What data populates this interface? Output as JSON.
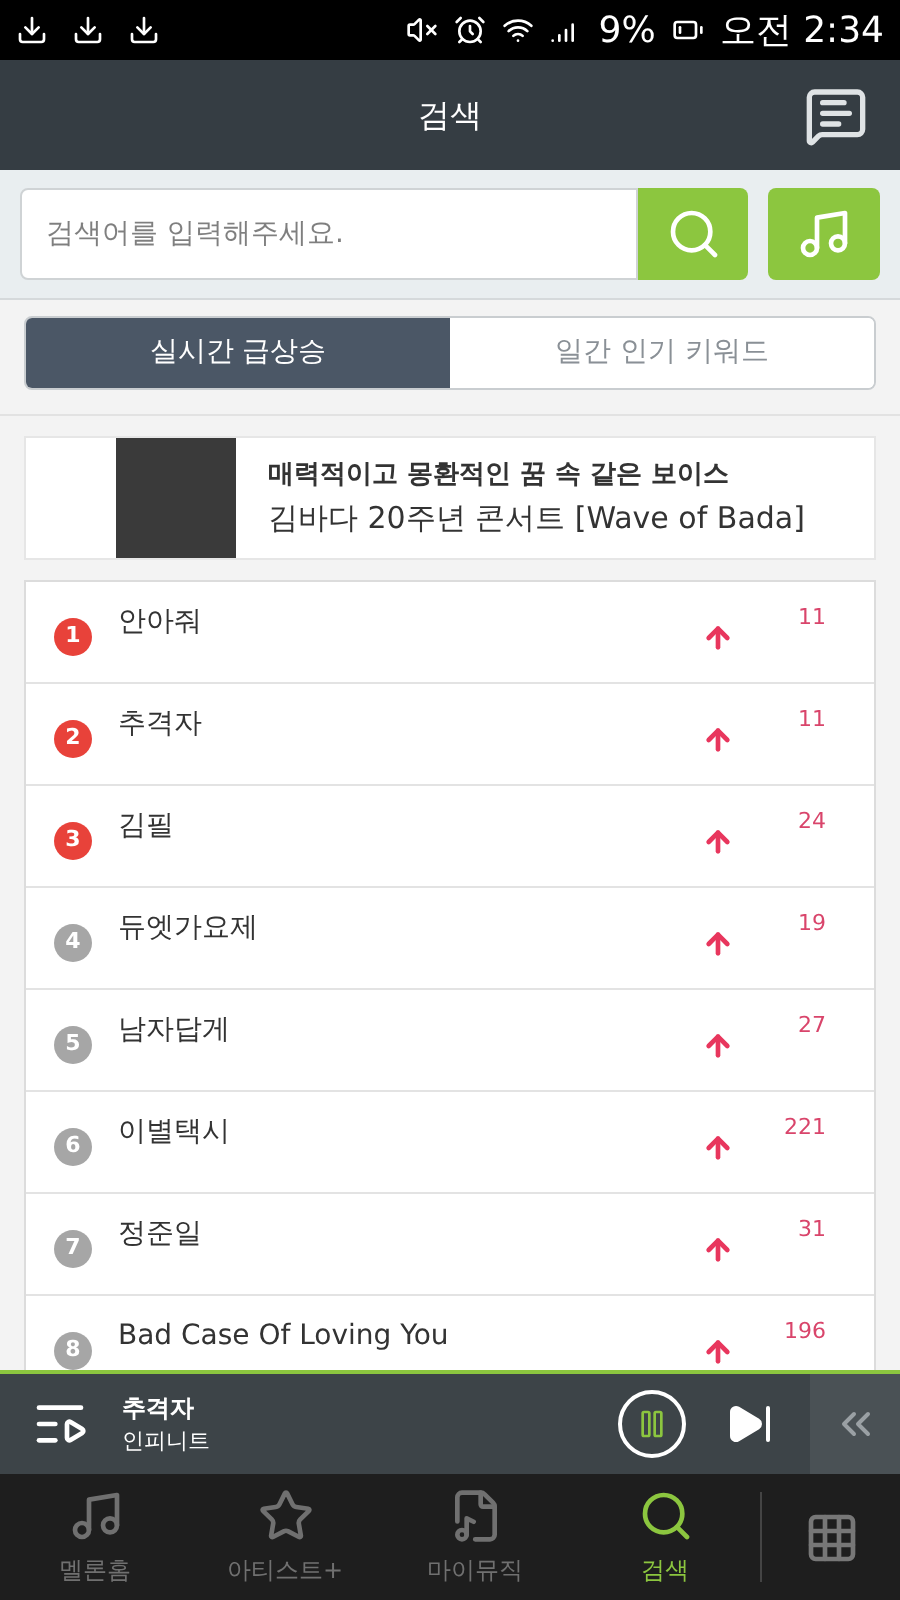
{
  "status_bar": {
    "battery": "9%",
    "time": "오전 2:34"
  },
  "header": {
    "title": "검색"
  },
  "search": {
    "placeholder": "검색어를 입력해주세요."
  },
  "tabs": [
    {
      "label": "실시간 급상승",
      "selected": true
    },
    {
      "label": "일간 인기 키워드",
      "selected": false
    }
  ],
  "banner": {
    "line_1": "매력적이고 몽환적인 꿈 속 같은 보이스",
    "line_2": "김바다 20주년 콘서트 [Wave of Bada]"
  },
  "keywords": [
    {
      "rank": "1",
      "color": "#e8423a",
      "keyword": "안아줘",
      "change": "11"
    },
    {
      "rank": "2",
      "color": "#e8423a",
      "keyword": "추격자",
      "change": "11"
    },
    {
      "rank": "3",
      "color": "#e8423a",
      "keyword": "김필",
      "change": "24"
    },
    {
      "rank": "4",
      "color": "#a6a6a6",
      "keyword": "듀엣가요제",
      "change": "19"
    },
    {
      "rank": "5",
      "color": "#a6a6a6",
      "keyword": "남자답게",
      "change": "27"
    },
    {
      "rank": "6",
      "color": "#a6a6a6",
      "keyword": "이별택시",
      "change": "221"
    },
    {
      "rank": "7",
      "color": "#a6a6a6",
      "keyword": "정준일",
      "change": "31"
    },
    {
      "rank": "8",
      "color": "#a6a6a6",
      "keyword": "Bad Case Of Loving You",
      "change": "196"
    }
  ],
  "player": {
    "title": "추격자",
    "artist": "인피니트",
    "playing": true
  },
  "bottom_nav": [
    {
      "label": "멜론홈",
      "kind": "home",
      "selected": false
    },
    {
      "label": "아티스트+",
      "kind": "artist",
      "selected": false
    },
    {
      "label": "마이뮤직",
      "kind": "library",
      "selected": false
    },
    {
      "label": "검색",
      "kind": "search",
      "selected": true
    }
  ]
}
